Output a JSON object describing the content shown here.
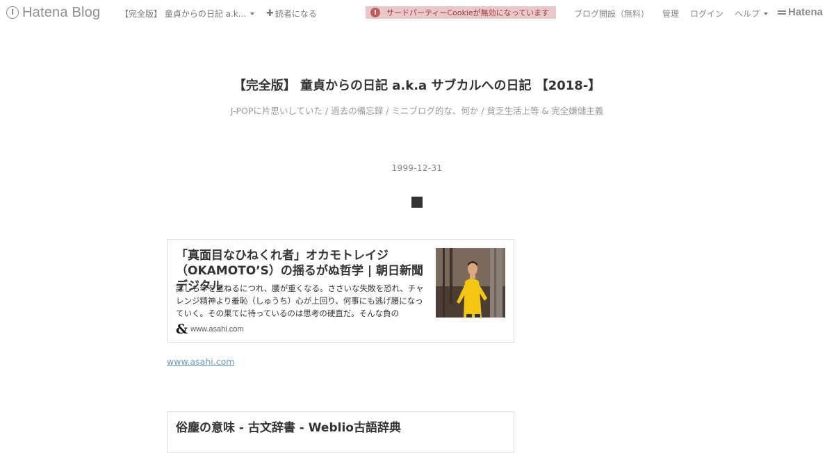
{
  "topbar": {
    "logo_text": "Hatena Blog",
    "blog_select_label": "【完全版】 童貞からの日記 a.k...",
    "subscribe_label": "読者になる",
    "cookie_warning": "サードパーティーCookieが無効になっています",
    "warning_icon_glyph": "!",
    "nav": {
      "open_blog": "ブログ開設（無料）",
      "admin": "管理",
      "login": "ログイン",
      "help": "ヘルプ"
    },
    "brand": "Hatena"
  },
  "blog": {
    "title": "【完全版】 童貞からの日記 a.k.a サブカルへの日記 【2018-】",
    "description": "J-POPに片思いしていた / 過去の備忘録 / ミニブログ的な、何か / 貧乏生活上等 & 完全嫌儲主義"
  },
  "entry": {
    "date": "1999-12-31",
    "title_glyph": "■"
  },
  "cards": [
    {
      "title": "「真面目なひねくれ者」オカモトレイジ（OKAMOTO’S）の揺るがぬ哲学 | 朝日新聞デジタル",
      "description": "誰しも年を重ねるにつれ、腰が重くなる。ささいな失敗を恐れ、チャレンジ精神より羞恥（しゅうち）心が上回り、何事にも逃げ腰になっていく。その果てに待っているのは思考の硬直だ。そんな負の",
      "favicon_glyph": "&",
      "domain": "www.asahi.com",
      "link_text": "www.asahi.com"
    },
    {
      "title": "俗塵の意味 - 古文辞書 - Weblio古語辞典"
    }
  ],
  "colors": {
    "warning_bg": "#e8c8c8",
    "warning_text": "#a53a3a",
    "link": "#6b9ac4",
    "thumb_jacket": "#f3c613"
  }
}
